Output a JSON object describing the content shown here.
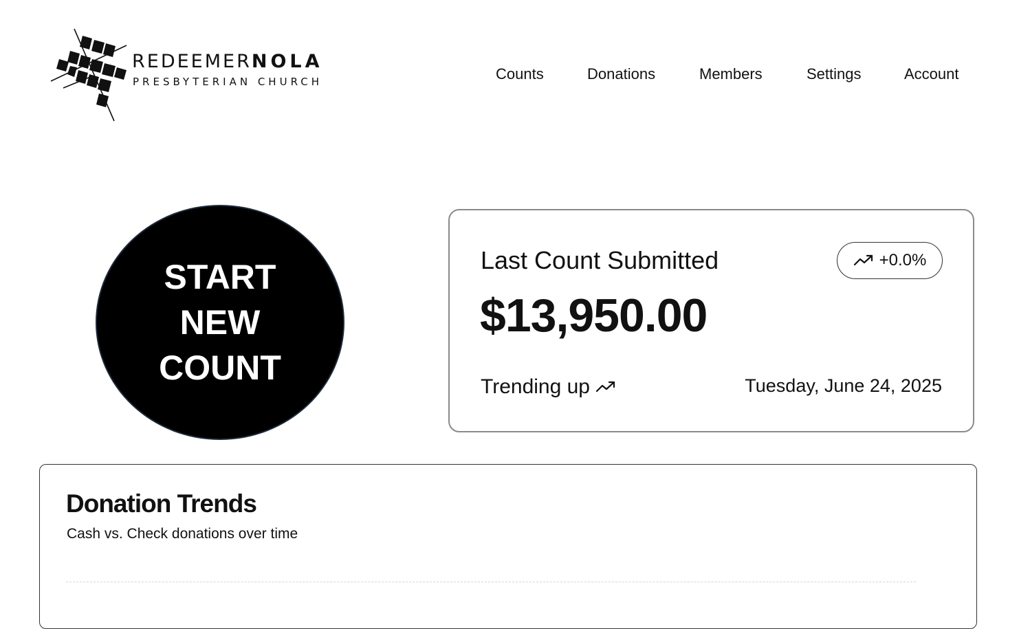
{
  "header": {
    "logo": {
      "line1_light": "REDEEMER",
      "line1_bold": "NOLA",
      "line2": "PRESBYTERIAN CHURCH"
    },
    "nav": [
      {
        "label": "Counts"
      },
      {
        "label": "Donations"
      },
      {
        "label": "Members"
      },
      {
        "label": "Settings"
      },
      {
        "label": "Account"
      }
    ]
  },
  "start_button": {
    "lines": [
      "START",
      "NEW",
      "COUNT"
    ]
  },
  "last_count_card": {
    "title": "Last Count Submitted",
    "amount": "$13,950.00",
    "badge": "+0.0%",
    "badge_icon": "trending-up-icon",
    "trend_label": "Trending up",
    "trend_icon": "trending-up-icon",
    "date": "Tuesday, June 24, 2025"
  },
  "donation_trends": {
    "title": "Donation Trends",
    "subtitle": "Cash vs. Check donations over time"
  },
  "colors": {
    "primary": "#000000",
    "text": "#111111",
    "card_border": "#8a8a8a",
    "gridline": "#d4d4d4"
  }
}
